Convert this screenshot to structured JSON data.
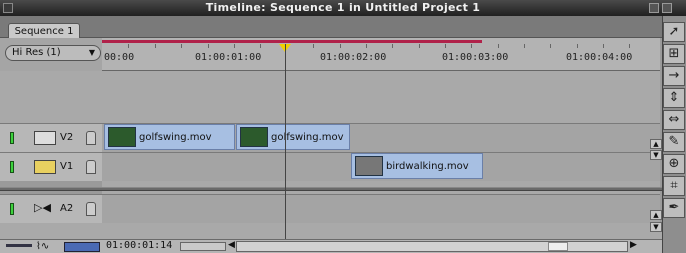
{
  "window": {
    "title": "Timeline: Sequence 1 in Untitled Project 1"
  },
  "tabs": [
    {
      "label": "Sequence 1"
    }
  ],
  "resolution_menu": {
    "value": "Hi Res (1)"
  },
  "ruler": {
    "timecodes": [
      "00:00",
      "01:00:01:00",
      "01:00:02:00",
      "01:00:03:00",
      "01:00:04:00"
    ]
  },
  "tracks": [
    {
      "name": "V2",
      "clips": [
        {
          "label": "golfswing.mov"
        },
        {
          "label": "golfswing.mov"
        }
      ]
    },
    {
      "name": "V1",
      "clips": [
        {
          "label": "birdwalking.mov"
        }
      ]
    },
    {
      "name": "A2",
      "clips": []
    }
  ],
  "current_timecode": "01:00:01:14",
  "colors": {
    "in_out_bar": "#b0224a",
    "clip": "#a7bfe2",
    "track_enabled": "#3cd23c",
    "playhead": "#f0d000"
  }
}
